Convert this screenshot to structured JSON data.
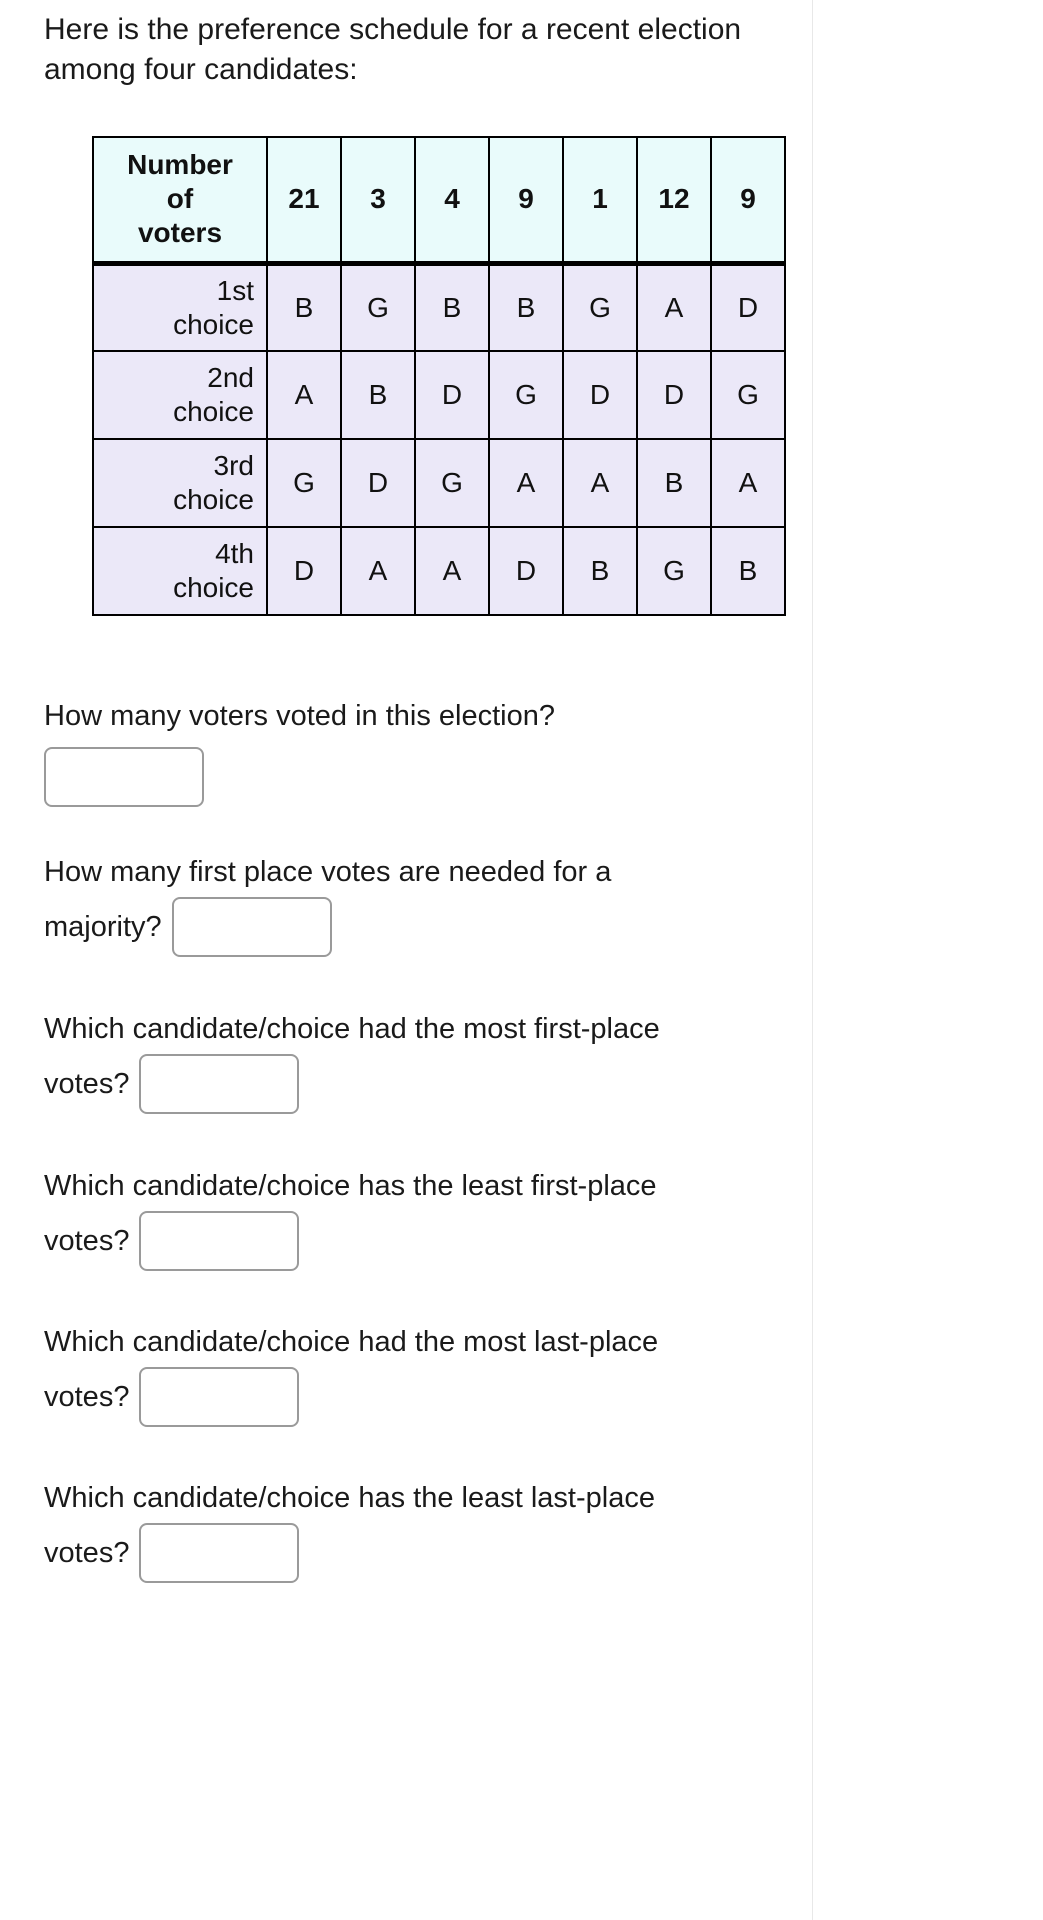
{
  "intro": {
    "text": "Here is the preference schedule for a recent election among four candidates:"
  },
  "table": {
    "header_label": "Number of voters",
    "header_label_lines": [
      "Number",
      "of",
      "voters"
    ],
    "voter_counts": [
      "21",
      "3",
      "4",
      "9",
      "1",
      "12",
      "9"
    ],
    "row_labels": [
      "1st choice",
      "2nd choice",
      "3rd choice",
      "4th choice"
    ],
    "row_label_lines": [
      [
        "1st",
        "choice"
      ],
      [
        "2nd",
        "choice"
      ],
      [
        "3rd",
        "choice"
      ],
      [
        "4th",
        "choice"
      ]
    ],
    "rows": [
      [
        "B",
        "G",
        "B",
        "B",
        "G",
        "A",
        "D"
      ],
      [
        "A",
        "B",
        "D",
        "G",
        "D",
        "D",
        "G"
      ],
      [
        "G",
        "D",
        "G",
        "A",
        "A",
        "B",
        "A"
      ],
      [
        "D",
        "A",
        "A",
        "D",
        "B",
        "G",
        "B"
      ]
    ],
    "header_bg": "#e9fbfb",
    "body_bg": "#ebe8f8",
    "border_color": "#000000"
  },
  "questions": [
    {
      "id": "total-voters",
      "lead": "How many voters voted in this election?",
      "trail": "",
      "value": "",
      "placeholder": "",
      "layout": "below"
    },
    {
      "id": "majority-votes",
      "lead": "How many first place votes are needed for a",
      "trail": "majority?",
      "value": "",
      "placeholder": "",
      "layout": "inline"
    },
    {
      "id": "most-first-place",
      "lead": "Which candidate/choice had the most first-place",
      "trail": "votes?",
      "value": "",
      "placeholder": "",
      "layout": "inline"
    },
    {
      "id": "least-first-place",
      "lead": "Which candidate/choice has the least first-place",
      "trail": "votes?",
      "value": "",
      "placeholder": "",
      "layout": "inline"
    },
    {
      "id": "most-last-place",
      "lead": "Which candidate/choice had the most last-place",
      "trail": "votes?",
      "value": "",
      "placeholder": "",
      "layout": "inline"
    },
    {
      "id": "least-last-place",
      "lead": "Which candidate/choice has the least last-place",
      "trail": "votes?",
      "value": "",
      "placeholder": "",
      "layout": "inline"
    }
  ]
}
